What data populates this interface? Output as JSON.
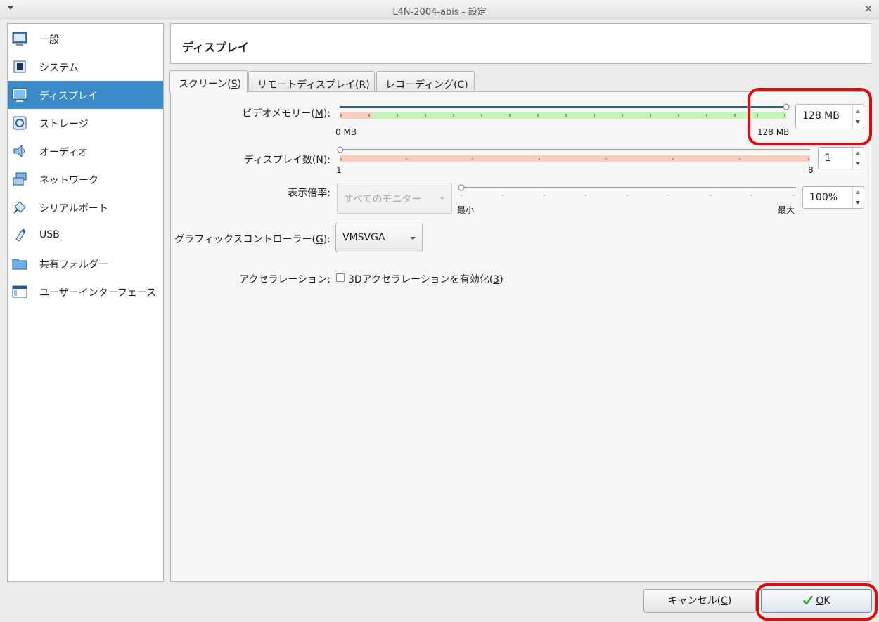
{
  "window": {
    "title": "L4N-2004-abis - 設定",
    "close_glyph": "✕"
  },
  "sidebar": {
    "items": [
      {
        "label": "一般",
        "icon": "general-icon"
      },
      {
        "label": "システム",
        "icon": "chip-icon"
      },
      {
        "label": "ディスプレイ",
        "icon": "monitor-icon",
        "selected": true
      },
      {
        "label": "ストレージ",
        "icon": "disk-icon"
      },
      {
        "label": "オーディオ",
        "icon": "speaker-icon"
      },
      {
        "label": "ネットワーク",
        "icon": "network-icon"
      },
      {
        "label": "シリアルポート",
        "icon": "serial-port-icon"
      },
      {
        "label": "USB",
        "icon": "usb-icon"
      },
      {
        "label": "共有フォルダー",
        "icon": "folder-icon"
      },
      {
        "label": "ユーザーインターフェース",
        "icon": "ui-window-icon"
      }
    ]
  },
  "header": {
    "title": "ディスプレイ"
  },
  "tabs": [
    {
      "pre": "スクリーン(",
      "key": "S",
      "post": ")",
      "active": true
    },
    {
      "pre": "リモートディスプレイ(",
      "key": "R",
      "post": ")"
    },
    {
      "pre": "レコーディング(",
      "key": "C",
      "post": ")"
    }
  ],
  "screen": {
    "video_memory": {
      "label_pre": "ビデオメモリー(",
      "label_key": "M",
      "label_post": "):",
      "min_label": "0 MB",
      "max_label": "128 MB",
      "value": "128 MB",
      "fraction": 1.0
    },
    "monitors": {
      "label_pre": "ディスプレイ数(",
      "label_key": "N",
      "label_post": "):",
      "min_label": "1",
      "max_label": "8",
      "value": "1",
      "fraction": 0.0
    },
    "scale": {
      "label": "表示倍率:",
      "monitor_select": "すべてのモニター",
      "min_label": "最小",
      "max_label": "最大",
      "value": "100%",
      "fraction": 0.0
    },
    "controller": {
      "label_pre": "グラフィックスコントローラー(",
      "label_key": "G",
      "label_post": "):",
      "value": "VMSVGA"
    },
    "acceleration": {
      "label": "アクセラレーション:",
      "checkbox_pre": "3Dアクセラレーションを有効化(",
      "checkbox_key": "3",
      "checkbox_post": ")",
      "checked": false
    }
  },
  "buttons": {
    "cancel": {
      "pre": "キャンセル(",
      "key": "C",
      "post": ")"
    },
    "ok": {
      "key": "O",
      "post": "K"
    }
  },
  "colors": {
    "selection": "#3b8bc9",
    "highlight": "#e00a0a",
    "slider_green": "#c6f5b9",
    "slider_red": "#f8cdbd"
  }
}
